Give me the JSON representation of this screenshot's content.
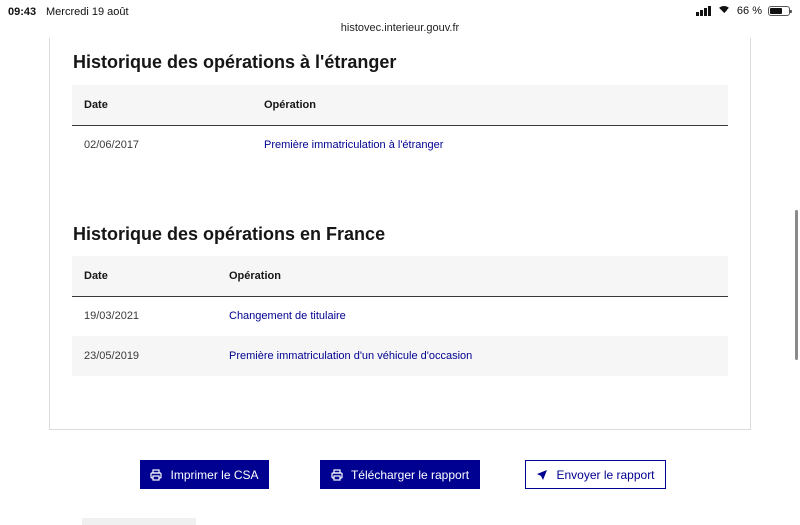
{
  "status_bar": {
    "time": "09:43",
    "date": "Mercredi 19 août",
    "battery": "66 %",
    "battery_level": 0.66
  },
  "browser": {
    "url": "histovec.interieur.gouv.fr"
  },
  "sections": {
    "etranger": {
      "title": "Historique des opérations à l'étranger",
      "columns": [
        "Date",
        "Opération"
      ],
      "rows": [
        {
          "date": "02/06/2017",
          "operation": "Première immatriculation à l'étranger"
        }
      ]
    },
    "france": {
      "title": "Historique des opérations en France",
      "columns": [
        "Date",
        "Opération"
      ],
      "rows": [
        {
          "date": "19/03/2021",
          "operation": "Changement de titulaire"
        },
        {
          "date": "23/05/2019",
          "operation": "Première immatriculation d'un véhicule d'occasion"
        }
      ]
    }
  },
  "actions": {
    "print_label": "Imprimer le CSA",
    "download_label": "Télécharger le rapport",
    "send_label": "Envoyer le rapport"
  },
  "colors": {
    "primary": "#000091",
    "row_alt": "#f6f6f6",
    "border": "#dcdcdc"
  }
}
